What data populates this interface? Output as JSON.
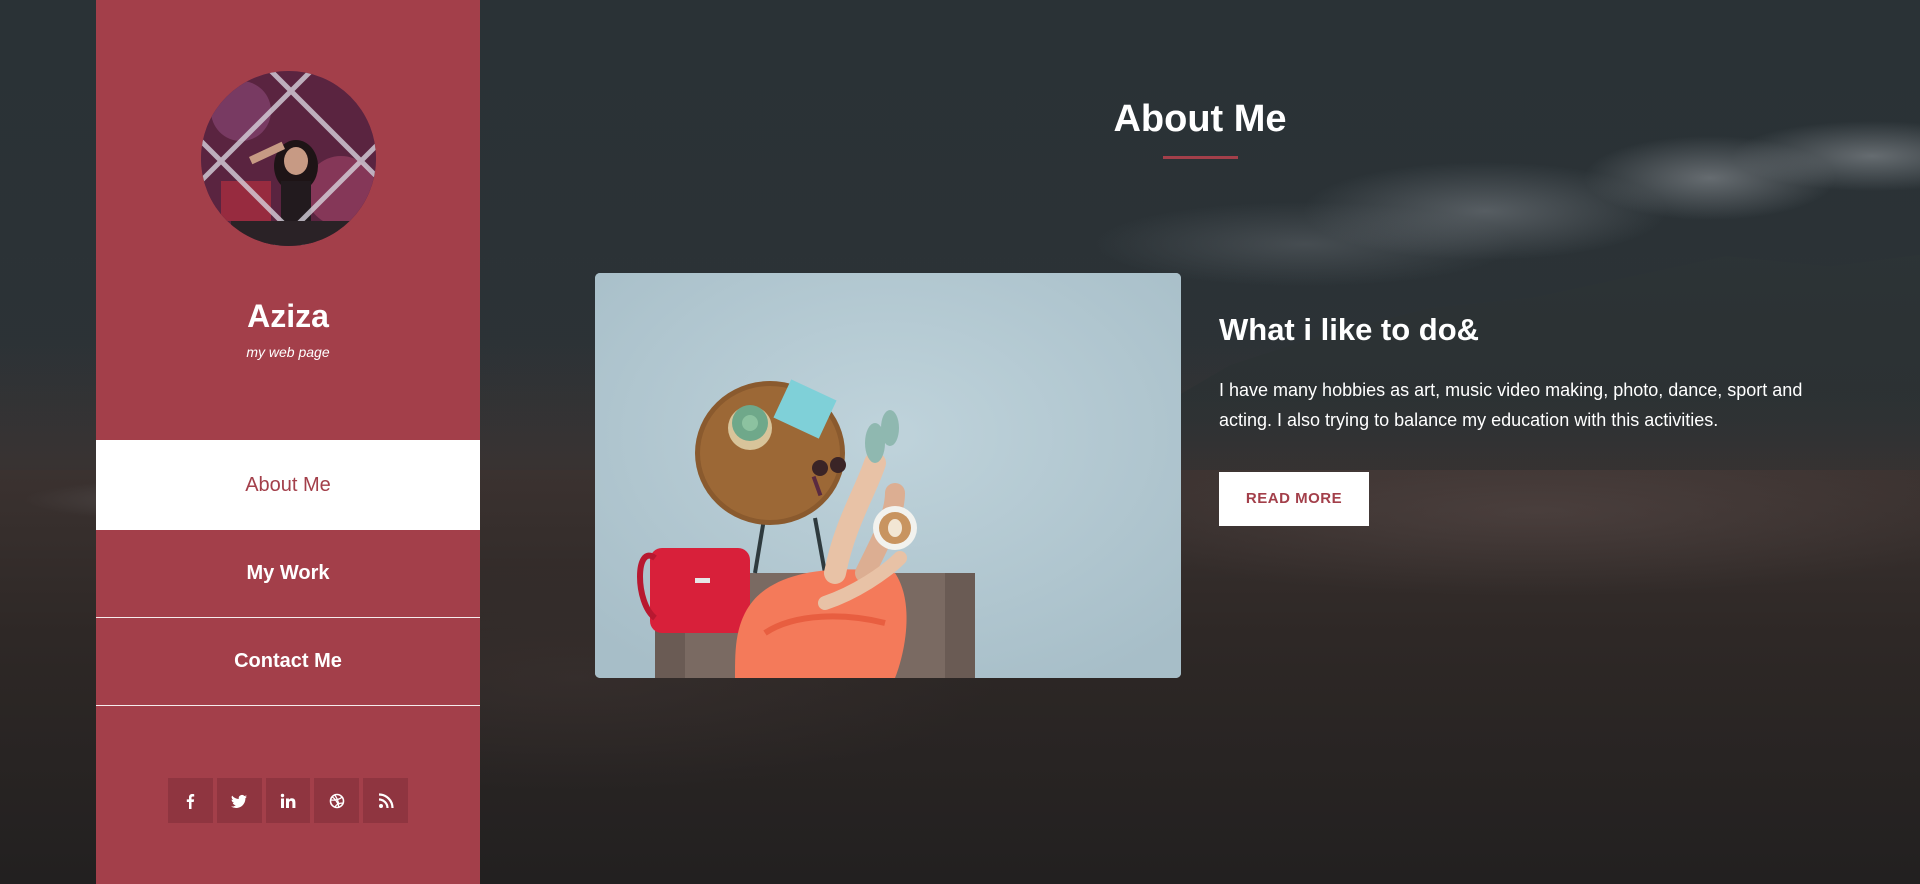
{
  "sidebar": {
    "name": "Aziza",
    "tagline": "my web page",
    "nav": [
      {
        "label": "About Me",
        "active": true
      },
      {
        "label": "My Work",
        "active": false
      },
      {
        "label": "Contact Me",
        "active": false
      }
    ],
    "social": [
      {
        "icon": "facebook-icon"
      },
      {
        "icon": "twitter-icon"
      },
      {
        "icon": "linkedin-icon"
      },
      {
        "icon": "dribbble-icon"
      },
      {
        "icon": "rss-icon"
      }
    ]
  },
  "main": {
    "title": "About Me",
    "feature": {
      "heading": "What i like to do&",
      "text": "I have many hobbies as art, music video making, photo, dance, sport and acting. I also trying to balance my education with this activities.",
      "button_label": "READ MORE"
    }
  },
  "colors": {
    "accent": "#a33f4a",
    "accent_dark": "#8f3540",
    "text": "#ffffff"
  }
}
